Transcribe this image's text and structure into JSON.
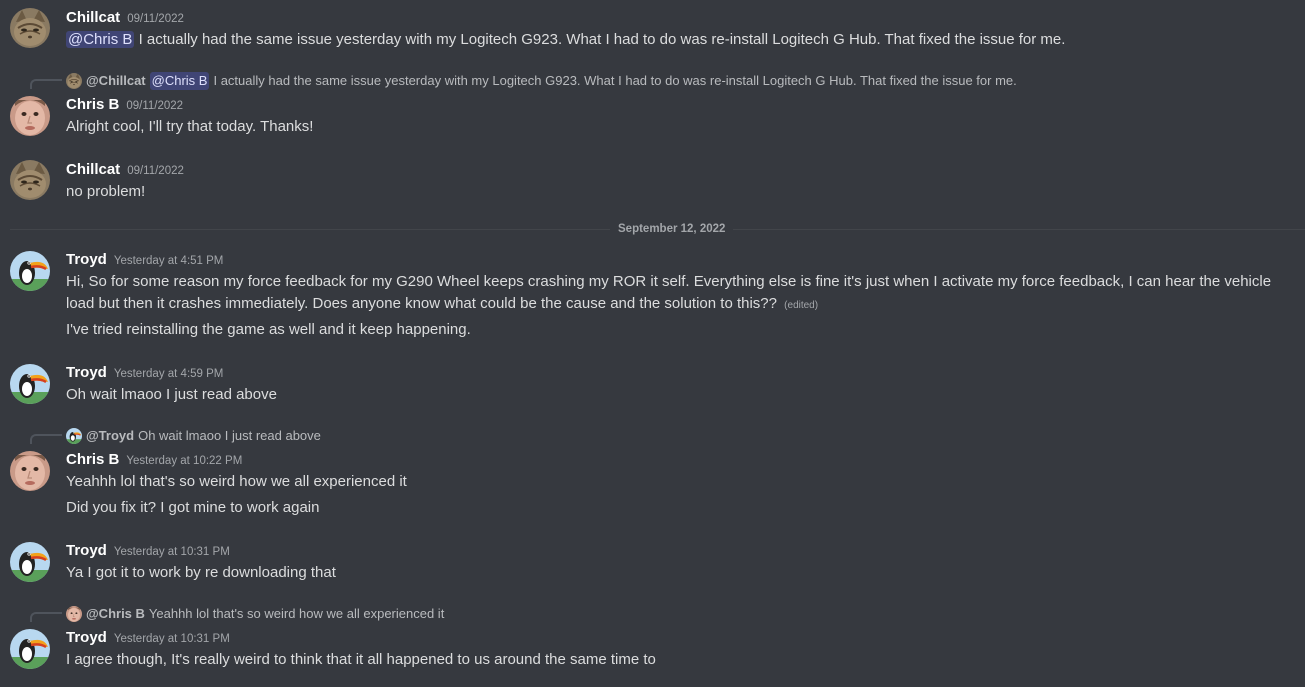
{
  "colors": {
    "background": "#36393f",
    "mention_bg": "#414675",
    "username": "#ffffff",
    "timestamp": "#a3a6aa"
  },
  "messages": [
    {
      "author": "Chillcat",
      "timestamp": "09/11/2022",
      "avatar_icon": "cat-avatar-icon",
      "mention": "@Chris B",
      "text": "I actually had the same issue yesterday with my Logitech G923. What I had to do was re-install Logitech G Hub. That fixed the issue for me."
    },
    {
      "reply": {
        "author": "@Chillcat",
        "mention": "@Chris B",
        "text": "I actually had the same issue yesterday with my Logitech G923. What I had to do was re-install Logitech G Hub. That fixed the issue for me."
      },
      "author": "Chris B",
      "timestamp": "09/11/2022",
      "avatar_icon": "face-avatar-icon",
      "text": "Alright cool, I'll try that today. Thanks!"
    },
    {
      "author": "Chillcat",
      "timestamp": "09/11/2022",
      "avatar_icon": "cat-avatar-icon",
      "text": "no problem!"
    },
    {
      "author": "Troyd",
      "timestamp": "Yesterday at 4:51 PM",
      "avatar_icon": "bird-avatar-icon",
      "text": "Hi, So for some reason my force feedback for my G290 Wheel keeps crashing my ROR it self. Everything else is fine it's just when I activate my force feedback, I can hear the vehicle load but then it crashes immediately. Does anyone know what could be the cause and the solution to this??",
      "edited": "(edited)",
      "text2": "I've tried reinstalling the game as well and it keep happening."
    },
    {
      "author": "Troyd",
      "timestamp": "Yesterday at 4:59 PM",
      "avatar_icon": "bird-avatar-icon",
      "text": "Oh wait lmaoo I just read above"
    },
    {
      "reply": {
        "author": "@Troyd",
        "text": "Oh wait lmaoo I just read above"
      },
      "author": "Chris B",
      "timestamp": "Yesterday at 10:22 PM",
      "avatar_icon": "face-avatar-icon",
      "text": "Yeahhh lol that's so weird how we all experienced it",
      "text2": "Did you fix it? I got mine to work again"
    },
    {
      "author": "Troyd",
      "timestamp": "Yesterday at 10:31 PM",
      "avatar_icon": "bird-avatar-icon",
      "text": "Ya I got it to work by re downloading that"
    },
    {
      "reply": {
        "author": "@Chris B",
        "text": "Yeahhh lol that's so weird how we all experienced it"
      },
      "author": "Troyd",
      "timestamp": "Yesterday at 10:31 PM",
      "avatar_icon": "bird-avatar-icon",
      "text": "I agree though, It's really weird to think that it all happened to us around the same time to"
    }
  ],
  "date_divider": "September 12, 2022"
}
